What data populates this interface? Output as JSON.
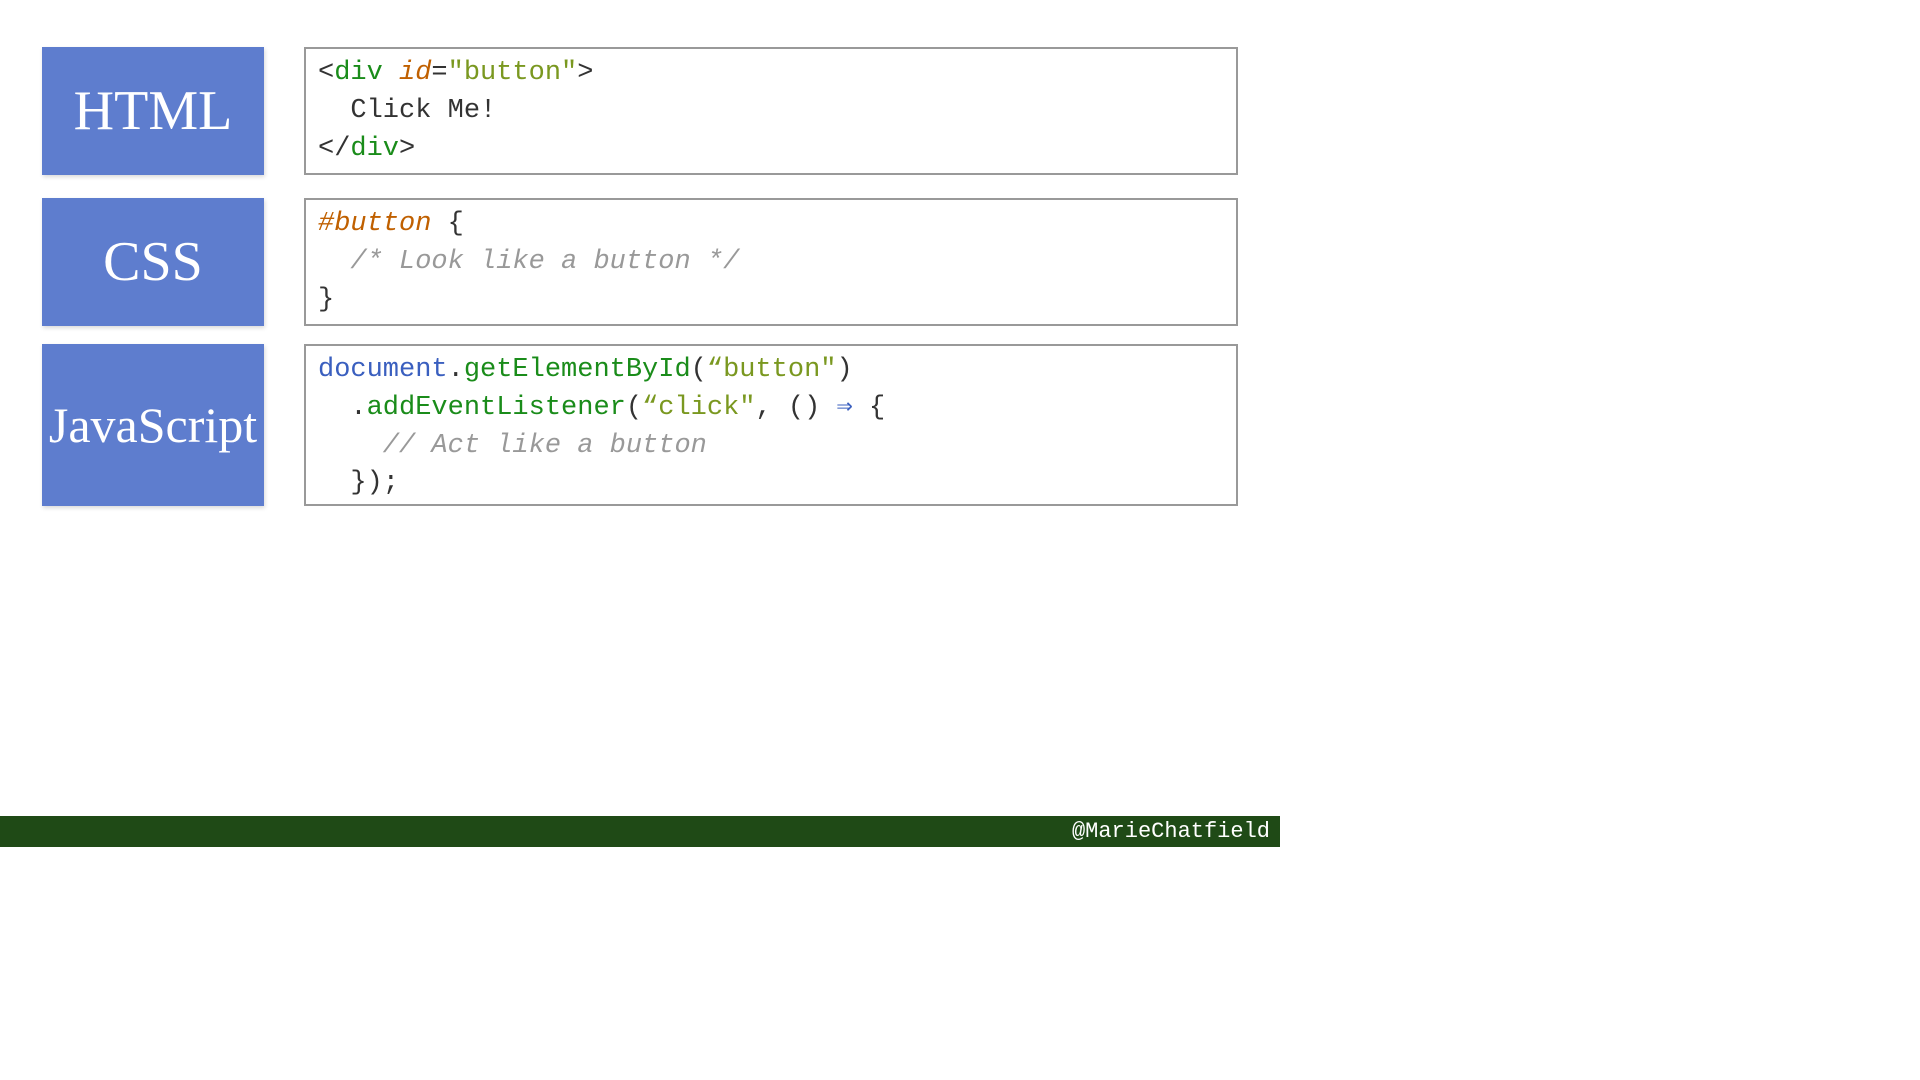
{
  "labels": {
    "html": "HTML",
    "css": "CSS",
    "js": "JavaScript"
  },
  "html_code": {
    "open_bracket": "<",
    "tag": "div",
    "space": " ",
    "attr": "id",
    "eq": "=",
    "val": "\"button\"",
    "close_bracket": ">",
    "content": "  Click Me!",
    "close_open": "</",
    "close_tag": "div",
    "close_close": ">"
  },
  "css_code": {
    "selector": "#button",
    "brace_open": " {",
    "comment": "  /* Look like a button */",
    "brace_close": "}"
  },
  "js_code": {
    "l1_obj": "document",
    "l1_dot": ".",
    "l1_method": "getElementById",
    "l1_open": "(",
    "l1_str": "“button\"",
    "l1_close": ")",
    "l2_indent": "  ",
    "l2_dot": ".",
    "l2_method": "addEventListener",
    "l2_open": "(",
    "l2_str": "“click\"",
    "l2_comma": ", ",
    "l2_paren": "()",
    "l2_arrow": " ⇒ ",
    "l2_brace": "{",
    "l3": "    // Act like a button",
    "l4": "  });"
  },
  "footer": "@MarieChatfield"
}
